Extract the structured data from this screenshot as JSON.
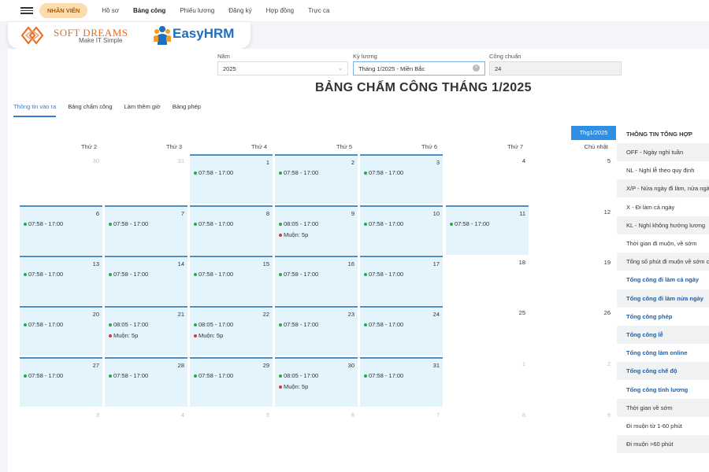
{
  "nav": {
    "role": "NHÂN VIÊN",
    "items": [
      "Hồ sơ",
      "Bảng công",
      "Phiếu lương",
      "Đăng ký",
      "Hợp đồng",
      "Trực ca"
    ]
  },
  "brand": {
    "softdreams_name": "SOFT DREAMS",
    "softdreams_tagline": "Make IT Simple",
    "easyhrm_name": "EasyHRM"
  },
  "filters": {
    "year_label": "Năm",
    "year_value": "2025",
    "period_label": "Kỳ lương",
    "period_value": "Tháng 1/2025 - Miền Bắc",
    "standard_label": "Công chuẩn",
    "standard_value": "24"
  },
  "page_title": "BẢNG CHẤM CÔNG THÁNG 1/2025",
  "tabs": [
    "Thông tin vào ra",
    "Bảng chấm công",
    "Làm thêm giờ",
    "Bảng phép"
  ],
  "month_button": "Thg1/2025",
  "weekdays": [
    "Thứ 2",
    "Thứ 3",
    "Thứ 4",
    "Thứ 5",
    "Thứ 6",
    "Thứ 7",
    "Chủ nhật"
  ],
  "calendar": [
    [
      {
        "day": "30",
        "out": true
      },
      {
        "day": "31",
        "out": true
      },
      {
        "day": "1",
        "work": true,
        "lines": [
          {
            "text": "07:58 - 17:00",
            "color": "green"
          }
        ]
      },
      {
        "day": "2",
        "work": true,
        "lines": [
          {
            "text": "07:58 - 17:00",
            "color": "green"
          }
        ]
      },
      {
        "day": "3",
        "work": true,
        "lines": [
          {
            "text": "07:58 - 17:00",
            "color": "green"
          }
        ]
      },
      {
        "day": "4"
      },
      {
        "day": "5"
      }
    ],
    [
      {
        "day": "6",
        "work": true,
        "lines": [
          {
            "text": "07:58 - 17:00",
            "color": "green"
          }
        ]
      },
      {
        "day": "7",
        "work": true,
        "lines": [
          {
            "text": "07:58 - 17:00",
            "color": "green"
          }
        ]
      },
      {
        "day": "8",
        "work": true,
        "lines": [
          {
            "text": "07:58 - 17:00",
            "color": "green"
          }
        ]
      },
      {
        "day": "9",
        "work": true,
        "lines": [
          {
            "text": "08:05 - 17:00",
            "color": "green"
          },
          {
            "text": "Muộn: 5p",
            "color": "red"
          }
        ]
      },
      {
        "day": "10",
        "work": true,
        "lines": [
          {
            "text": "07:58 - 17:00",
            "color": "green"
          }
        ]
      },
      {
        "day": "11",
        "work": true,
        "lines": [
          {
            "text": "07:58 - 17:00",
            "color": "green"
          }
        ]
      },
      {
        "day": "12"
      }
    ],
    [
      {
        "day": "13",
        "work": true,
        "lines": [
          {
            "text": "07:58 - 17:00",
            "color": "green"
          }
        ]
      },
      {
        "day": "14",
        "work": true,
        "lines": [
          {
            "text": "07:58 - 17:00",
            "color": "green"
          }
        ]
      },
      {
        "day": "15",
        "work": true,
        "lines": [
          {
            "text": "07:58 - 17:00",
            "color": "green"
          }
        ]
      },
      {
        "day": "16",
        "work": true,
        "lines": [
          {
            "text": "07:58 - 17:00",
            "color": "green"
          }
        ]
      },
      {
        "day": "17",
        "work": true,
        "lines": [
          {
            "text": "07:58 - 17:00",
            "color": "green"
          }
        ]
      },
      {
        "day": "18"
      },
      {
        "day": "19"
      }
    ],
    [
      {
        "day": "20",
        "work": true,
        "lines": [
          {
            "text": "07:58 - 17:00",
            "color": "green"
          }
        ]
      },
      {
        "day": "21",
        "work": true,
        "lines": [
          {
            "text": "08:05 - 17:00",
            "color": "green"
          },
          {
            "text": "Muộn: 5p",
            "color": "red"
          }
        ]
      },
      {
        "day": "22",
        "work": true,
        "lines": [
          {
            "text": "08:05 - 17:00",
            "color": "green"
          },
          {
            "text": "Muộn: 5p",
            "color": "red"
          }
        ]
      },
      {
        "day": "23",
        "work": true,
        "lines": [
          {
            "text": "07:58 - 17:00",
            "color": "green"
          }
        ]
      },
      {
        "day": "24",
        "work": true,
        "lines": [
          {
            "text": "07:58 - 17:00",
            "color": "green"
          }
        ]
      },
      {
        "day": "25"
      },
      {
        "day": "26"
      }
    ],
    [
      {
        "day": "27",
        "work": true,
        "lines": [
          {
            "text": "07:58 - 17:00",
            "color": "green"
          }
        ]
      },
      {
        "day": "28",
        "work": true,
        "lines": [
          {
            "text": "07:58 - 17:00",
            "color": "green"
          }
        ]
      },
      {
        "day": "29",
        "work": true,
        "lines": [
          {
            "text": "07:58 - 17:00",
            "color": "green"
          }
        ]
      },
      {
        "day": "30",
        "work": true,
        "lines": [
          {
            "text": "08:05 - 17:00",
            "color": "green"
          },
          {
            "text": "Muộn: 5p",
            "color": "red"
          }
        ]
      },
      {
        "day": "31",
        "work": true,
        "lines": [
          {
            "text": "07:58 - 17:00",
            "color": "green"
          }
        ]
      },
      {
        "day": "1",
        "out": true
      },
      {
        "day": "2",
        "out": true
      }
    ],
    [
      {
        "day": "3",
        "out": true
      },
      {
        "day": "4",
        "out": true
      },
      {
        "day": "5",
        "out": true
      },
      {
        "day": "6",
        "out": true
      },
      {
        "day": "7",
        "out": true
      },
      {
        "day": "8",
        "out": true
      },
      {
        "day": "9",
        "out": true
      }
    ]
  ],
  "summary": {
    "title": "THÔNG TIN TỔNG HỢP",
    "rows": [
      {
        "text": "OFF - Ngày nghỉ tuần",
        "blue": false
      },
      {
        "text": "NL - Nghỉ lễ theo quy định",
        "blue": false
      },
      {
        "text": "X/P - Nửa ngày đi làm, nửa ngày",
        "blue": false
      },
      {
        "text": "X - Đi làm cả ngày",
        "blue": false
      },
      {
        "text": "KL - Nghỉ không hưởng lương",
        "blue": false
      },
      {
        "text": "Thời gian đi muộn, về sớm",
        "blue": false
      },
      {
        "text": "Tổng số phút đi muộn về sớm c",
        "blue": false
      },
      {
        "text": "Tổng công đi làm cả ngày",
        "blue": true
      },
      {
        "text": "Tổng công đi làm nửa ngày",
        "blue": true
      },
      {
        "text": "Tổng công phép",
        "blue": true
      },
      {
        "text": "Tổng công lễ",
        "blue": true
      },
      {
        "text": "Tổng công làm online",
        "blue": true
      },
      {
        "text": "Tổng công chế độ",
        "blue": true
      },
      {
        "text": "Tổng công tính lương",
        "blue": true
      },
      {
        "text": "Thời gian về sớm",
        "blue": false
      },
      {
        "text": "Đi muộn từ 1-60 phút",
        "blue": false
      },
      {
        "text": "Đi muộn >60 phút",
        "blue": false
      }
    ]
  },
  "colors": {
    "accent": "#2d8fe6",
    "work_cell": "#e3f4fc",
    "late": "#d9363e",
    "present": "#28a745"
  }
}
